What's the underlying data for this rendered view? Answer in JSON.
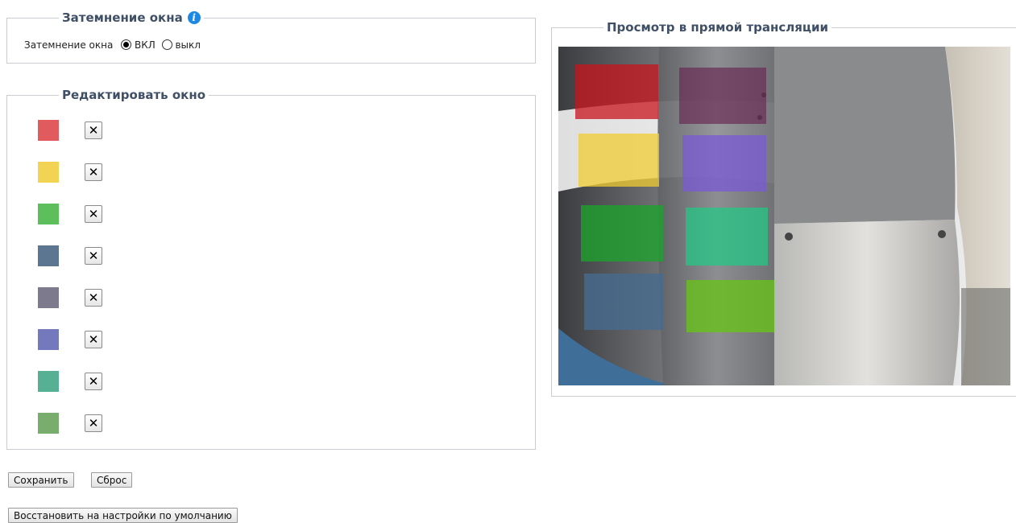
{
  "blackout": {
    "title": "Затемнение окна",
    "label": "Затемнение окна",
    "on_label": "ВКЛ",
    "off_label": "выкл",
    "selected": "on"
  },
  "edit": {
    "title": "Редактировать окно",
    "masks": [
      {
        "color": "#e05a5e",
        "delete_label": "✕"
      },
      {
        "color": "#f2d354",
        "delete_label": "✕"
      },
      {
        "color": "#5cbf5b",
        "delete_label": "✕"
      },
      {
        "color": "#5c7691",
        "delete_label": "✕"
      },
      {
        "color": "#7d7a8e",
        "delete_label": "✕"
      },
      {
        "color": "#7479bd",
        "delete_label": "✕"
      },
      {
        "color": "#55b094",
        "delete_label": "✕"
      },
      {
        "color": "#78ad6e",
        "delete_label": "✕"
      }
    ]
  },
  "preview": {
    "title": "Просмотр в прямой трансляции"
  },
  "buttons": {
    "save": "Сохранить",
    "reset": "Сброс",
    "restore_defaults": "Восстановить на настройки по умолчанию"
  }
}
